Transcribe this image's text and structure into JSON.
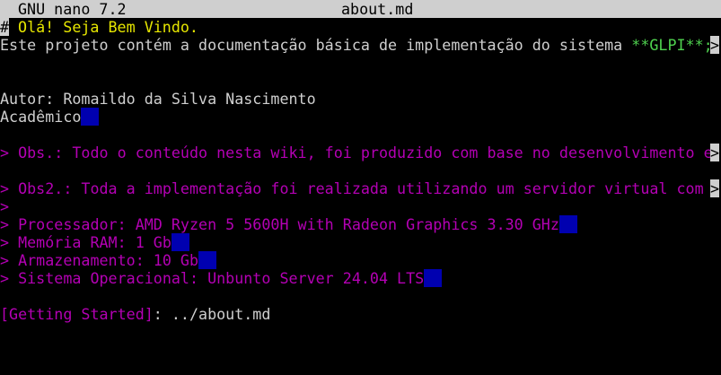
{
  "titlebar": {
    "app": "GNU nano 7.2",
    "filename": "about.md"
  },
  "editor": {
    "line1_hash": "#",
    "line1_text": " Olá! Seja Bem Vindo.",
    "line2_text": "Este projeto contém a documentação básica de implementação do sistema ",
    "line2_bold": "**GLPI**;",
    "more_glyph": ">",
    "author": "Autor: Romaildo da Silva Nascimento",
    "role": "Acadêmico",
    "obs1": "> Obs.: Todo o conteúdo nesta wiki, foi produzido com base no desenvolvimento e",
    "obs2": "> Obs2.: Toda a implementação foi realizada utilizando um servidor virtual com ",
    "quote_empty": ">",
    "cpu": "> Processador: AMD Ryzen 5 5600H with Radeon Graphics 3.30 GHz",
    "ram": "> Memória RAM: 1 Gb",
    "storage": "> Armazenamento: 10 Gb",
    "os": "> Sistema Operacional: Unbunto Server 24.04 LTS",
    "link_label": "[Getting Started]",
    "link_target": ": ../about.md"
  },
  "colors": {
    "heading": "#e6e600",
    "quote": "#b400b4",
    "bold": "#4fd24f",
    "trailing_whitespace": "#0000b0",
    "titlebar_bg": "#cfcfcf"
  }
}
